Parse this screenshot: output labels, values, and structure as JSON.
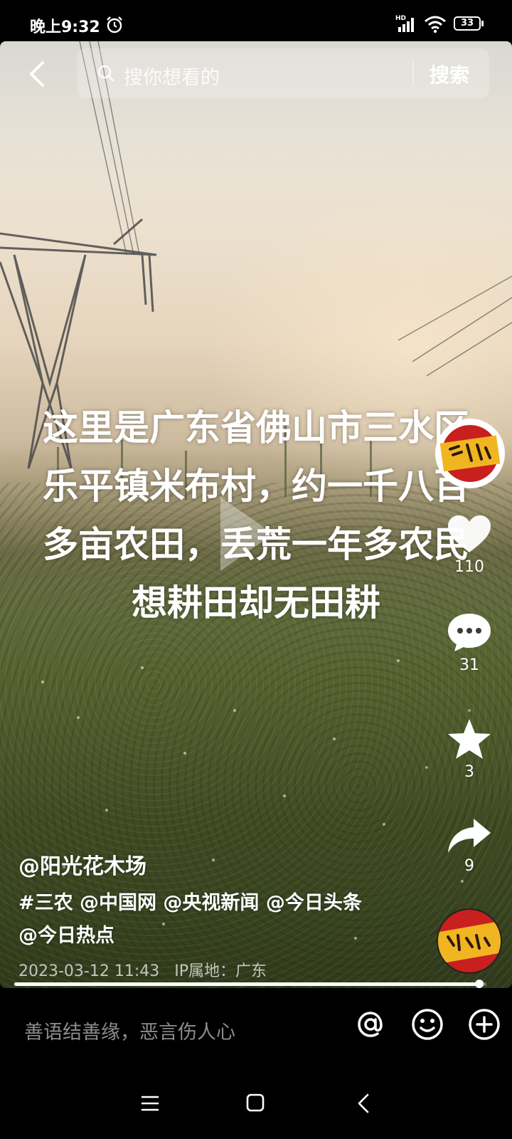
{
  "status_bar": {
    "time": "晚上9:32",
    "network_label": "HD",
    "battery": "33"
  },
  "search": {
    "placeholder": "搜你想看的",
    "button_label": "搜索"
  },
  "video": {
    "caption_lines": [
      "这里是广东省佛山市三水区",
      "乐平镇米布村，约一千八百",
      "多亩农田，丢荒一年多农民",
      "想耕田却无田耕"
    ],
    "progress": 0.985
  },
  "actions": {
    "like_count": "110",
    "comment_count": "31",
    "favorite_count": "3",
    "share_count": "9"
  },
  "post": {
    "author": "@阳光花木场",
    "description": "#三农 @中国网 @央视新闻 @今日头条 @今日热点",
    "date": "2023-03-12 11:43",
    "ip_location": "IP属地：广东"
  },
  "comment_bar": {
    "placeholder": "善语结善缘，恶言伤人心"
  },
  "icons": {
    "back": "chevron-left-icon",
    "search": "search-icon",
    "like": "heart-icon",
    "comment": "speech-bubble-icon",
    "favorite": "star-icon",
    "share": "share-arrow-icon",
    "at": "at-sign-icon",
    "emoji": "emoji-icon",
    "add": "plus-circle-icon"
  },
  "colors": {
    "avatar_red": "#c8201e",
    "avatar_gold": "#f2b522",
    "comment_placeholder": "#8c8c8c"
  }
}
